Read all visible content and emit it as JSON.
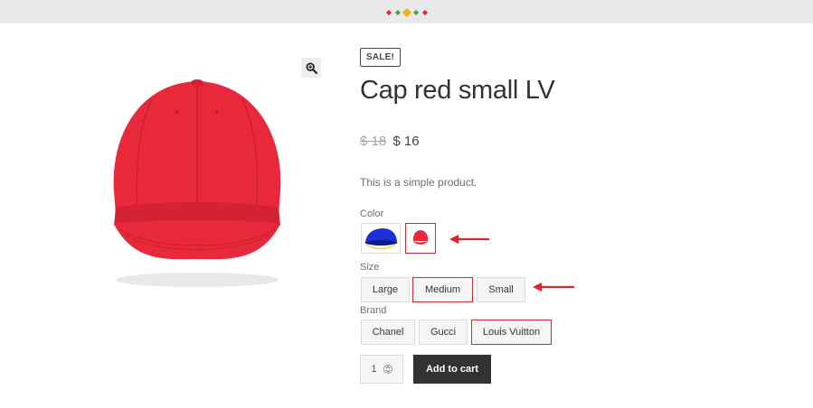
{
  "header": {
    "logo_icon": "diamond-dots-logo",
    "logo_colors": [
      "#e0242b",
      "#e0242b",
      "#f2b400",
      "#3aaa35",
      "#e0242b"
    ]
  },
  "gallery": {
    "zoom_icon": "zoom-in-icon",
    "image_subject": "red baseball cap"
  },
  "product": {
    "badge": "SALE!",
    "title": "Cap red small LV",
    "price_old": "$ 18",
    "price_new": "$ 16",
    "description": "This is a simple product."
  },
  "attributes": {
    "color": {
      "label": "Color",
      "swatches": [
        {
          "name": "blue cap",
          "color": "#1c2fd6",
          "selected": false
        },
        {
          "name": "red cap",
          "color": "#e8283b",
          "selected": true
        }
      ]
    },
    "size": {
      "label": "Size",
      "options": [
        "Large",
        "Medium",
        "Small"
      ],
      "selected": "Medium"
    },
    "brand": {
      "label": "Brand",
      "options": [
        "Chanel",
        "Gucci",
        "Louis Vuitton"
      ],
      "selected": "Louis Vuitton"
    }
  },
  "cart": {
    "quantity": "1",
    "add_label": "Add to cart"
  },
  "annotations": {
    "arrow_color": "#e0242b"
  },
  "colors": {
    "accent_red": "#e0242b",
    "button_dark": "#333333",
    "page_bg": "#e9e9eb"
  }
}
